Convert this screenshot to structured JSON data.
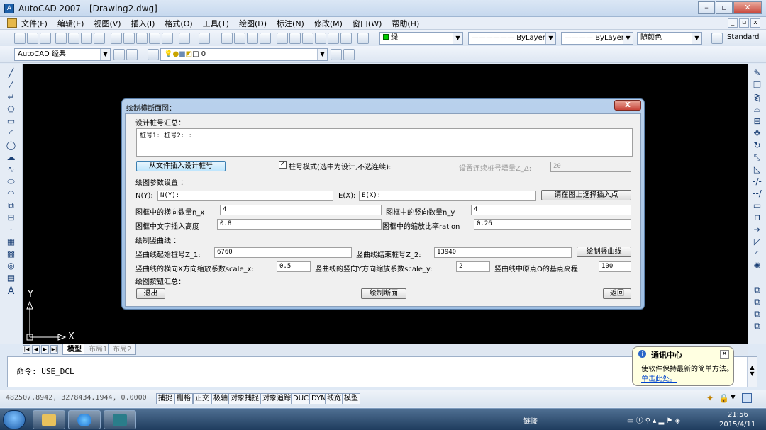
{
  "window": {
    "title": "AutoCAD 2007 - [Drawing2.dwg]",
    "icon": "autocad-icon"
  },
  "menu": [
    "文件(F)",
    "编辑(E)",
    "视图(V)",
    "插入(I)",
    "格式(O)",
    "工具(T)",
    "绘图(D)",
    "标注(N)",
    "修改(M)",
    "窗口(W)",
    "帮助(H)"
  ],
  "toolbar": {
    "layer_color": "绿",
    "linetype": "ByLayer",
    "lineweight": "ByLayer",
    "plotstyle": "随颜色",
    "textstyle": "Standard",
    "workspace": "AutoCAD 经典",
    "layer_name": "0"
  },
  "ucs": {
    "y": "Y",
    "x": "X"
  },
  "layout_tabs": [
    "模型",
    "布局1",
    "布局2"
  ],
  "command": {
    "prompt": "命令: USE_DCL"
  },
  "status": {
    "coords": "482507.8942, 3278434.1944, 0.0000",
    "buttons": [
      "捕捉",
      "栅格",
      "正交",
      "极轴",
      "对象捕捉",
      "对象追踪",
      "DUCS",
      "DYN",
      "线宽",
      "模型"
    ]
  },
  "notification": {
    "title": "通讯中心",
    "body": "使软件保持最新的简单方法。",
    "link": "单击此处。"
  },
  "taskbar": {
    "label": "链接",
    "time": "21:56",
    "date": "2015/4/11"
  },
  "dialog": {
    "title": "绘制横断面图：",
    "close": "X",
    "sec_design": "设计桩号汇总：",
    "stations_text": "桩号1: 桩号2: :",
    "insert_btn": "从文件插入设计桩号",
    "mode_chk": "桩号模式(选中为设计,不选连续):",
    "mode_checked": true,
    "increment_label": "设置连续桩号增量Z_Δ:",
    "increment_value": "20",
    "sec_params": "绘图参数设置 ：",
    "n_label": "N(Y):",
    "n_value": "N(Y):",
    "e_label": "E(X):",
    "e_value": "E(X):",
    "pick_btn": "请在图上选择插入点",
    "nx_label": "图框中的横向数量n_x",
    "nx_value": "4",
    "ny_label": "图框中的竖向数量n_y",
    "ny_value": "4",
    "height_label": "图框中文字插入高度",
    "height_value": "0.8",
    "ratio_label": "图框中的缩放比率ration",
    "ratio_value": "0.26",
    "sec_curve": "绘制竖曲线 ：",
    "z1_label": "竖曲线起始桩号Z_1:",
    "z1_value": "6760",
    "z2_label": "竖曲线结束桩号Z_2:",
    "z2_value": "13940",
    "draw_curve_btn": "绘制竖曲线",
    "sx_label": "竖曲线的横向X方向缩放系数scale_x:",
    "sx_value": "0.5",
    "sy_label": "竖曲线的竖向Y方向缩放系数scale_y:",
    "sy_value": "2",
    "base_label": "竖曲线中原点O的基点高程:",
    "base_value": "100",
    "sec_buttons": "绘图按钮汇总：",
    "exit_btn": "退出",
    "draw_btn": "绘制断面",
    "back_btn": "返回"
  }
}
